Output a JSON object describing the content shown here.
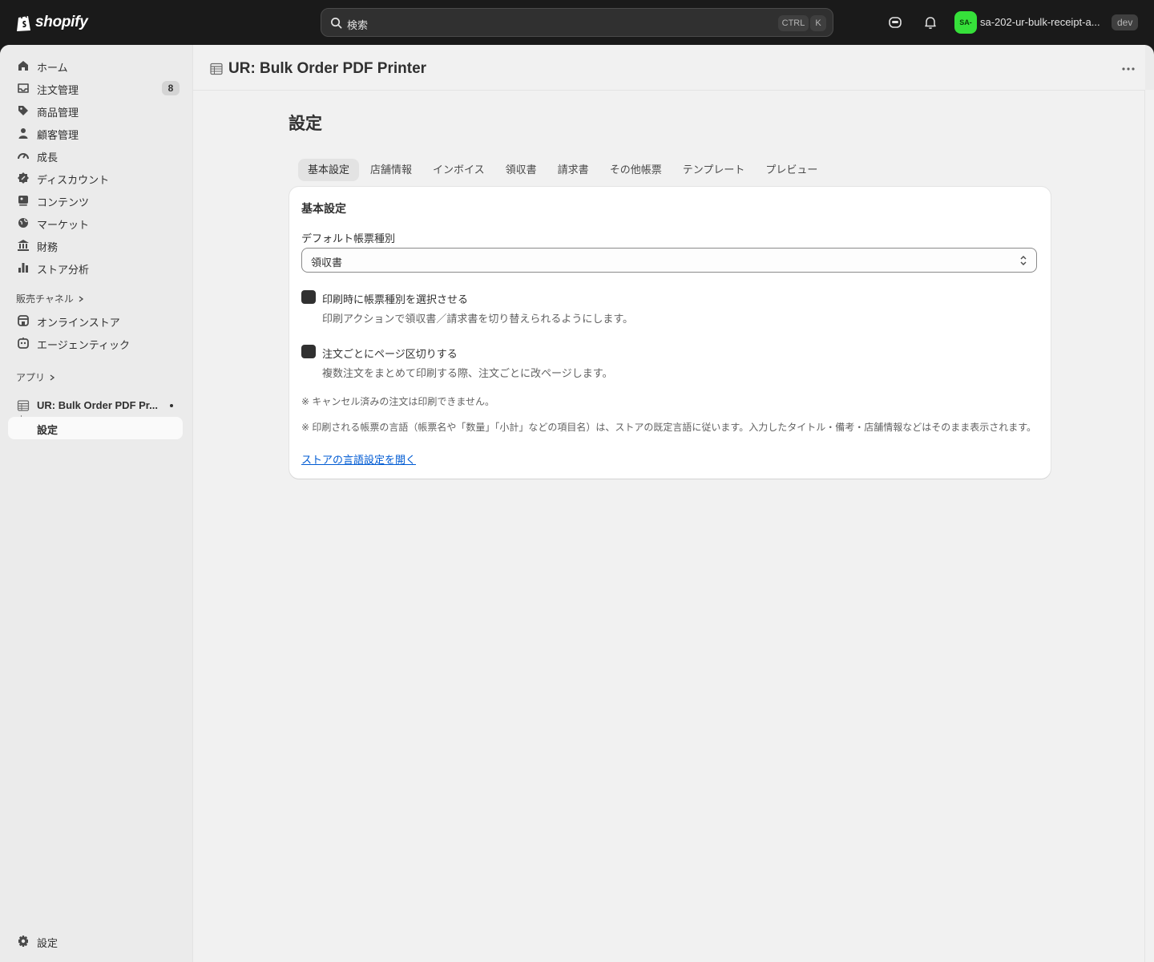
{
  "topbar": {
    "logo_text": "shopify",
    "search_placeholder": "検索",
    "shortcut_ctrl": "CTRL",
    "shortcut_key": "K",
    "account_initials": "SA-",
    "account_name": "sa-202-ur-bulk-receipt-a...",
    "env_badge": "dev"
  },
  "sidebar": {
    "items": [
      {
        "label": "ホーム",
        "icon": "home-icon"
      },
      {
        "label": "注文管理",
        "icon": "orders-icon",
        "count": "8"
      },
      {
        "label": "商品管理",
        "icon": "tag-icon"
      },
      {
        "label": "顧客管理",
        "icon": "person-icon"
      },
      {
        "label": "成長",
        "icon": "gauge-icon"
      },
      {
        "label": "ディスカウント",
        "icon": "discount-icon"
      },
      {
        "label": "コンテンツ",
        "icon": "content-icon"
      },
      {
        "label": "マーケット",
        "icon": "globe-icon"
      },
      {
        "label": "財務",
        "icon": "bank-icon"
      },
      {
        "label": "ストア分析",
        "icon": "chart-icon"
      }
    ],
    "sales_channels_label": "販売チャネル",
    "channels": [
      {
        "label": "オンラインストア",
        "icon": "store-icon"
      },
      {
        "label": "エージェンティック",
        "icon": "agentic-icon"
      }
    ],
    "apps_label": "アプリ",
    "app_item": "UR: Bulk Order PDF Pr...",
    "app_sub_item": "設定",
    "settings_label": "設定"
  },
  "page": {
    "app_title": "UR: Bulk Order PDF Printer",
    "heading": "設定",
    "tabs": [
      "基本設定",
      "店舗情報",
      "インボイス",
      "領収書",
      "請求書",
      "その他帳票",
      "テンプレート",
      "プレビュー"
    ],
    "selected_tab": "基本設定"
  },
  "card": {
    "title": "基本設定",
    "default_type_label": "デフォルト帳票種別",
    "default_type_value": "領収書",
    "checkbox1_label": "印刷時に帳票種別を選択させる",
    "checkbox1_help": "印刷アクションで領収書／請求書を切り替えられるようにします。",
    "checkbox2_label": "注文ごとにページ区切りする",
    "checkbox2_help": "複数注文をまとめて印刷する際、注文ごとに改ページします。",
    "note1": "※ キャンセル済みの注文は印刷できません。",
    "note2": "※ 印刷される帳票の言語（帳票名や「数量」「小計」などの項目名）は、ストアの既定言語に従います。入力したタイトル・備考・店舗情報などはそのまま表示されます。",
    "link": "ストアの言語設定を開く"
  },
  "colors": {
    "topbar_bg": "#1a1a1a",
    "avatar_bg": "#36e03a",
    "link": "#005bd3"
  }
}
